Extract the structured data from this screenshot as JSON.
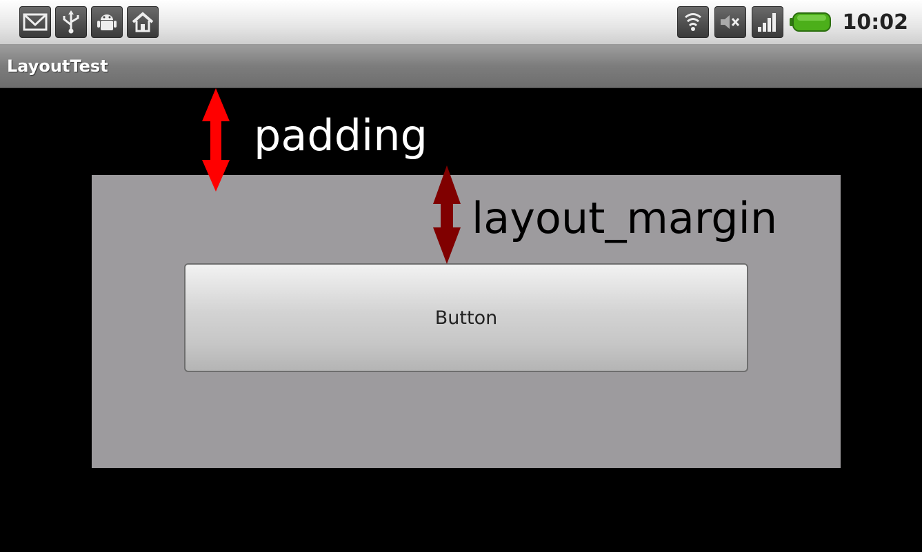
{
  "status_bar": {
    "notification_icons": [
      "gmail-icon",
      "usb-icon",
      "android-debug-icon",
      "home-icon"
    ],
    "system_icons": [
      "wifi-icon",
      "volume-muted-icon",
      "signal-icon",
      "battery-icon"
    ],
    "time": "10:02"
  },
  "app": {
    "title": "LayoutTest"
  },
  "content": {
    "button_label": "Button"
  },
  "annotations": {
    "padding_label": "padding",
    "padding_arrow_color": "#ff0000",
    "margin_label": "layout_margin",
    "margin_arrow_color": "#800000"
  },
  "colors": {
    "layout_background": "#9d9b9e",
    "screen_background": "#000000",
    "battery": "#4caf1a"
  }
}
